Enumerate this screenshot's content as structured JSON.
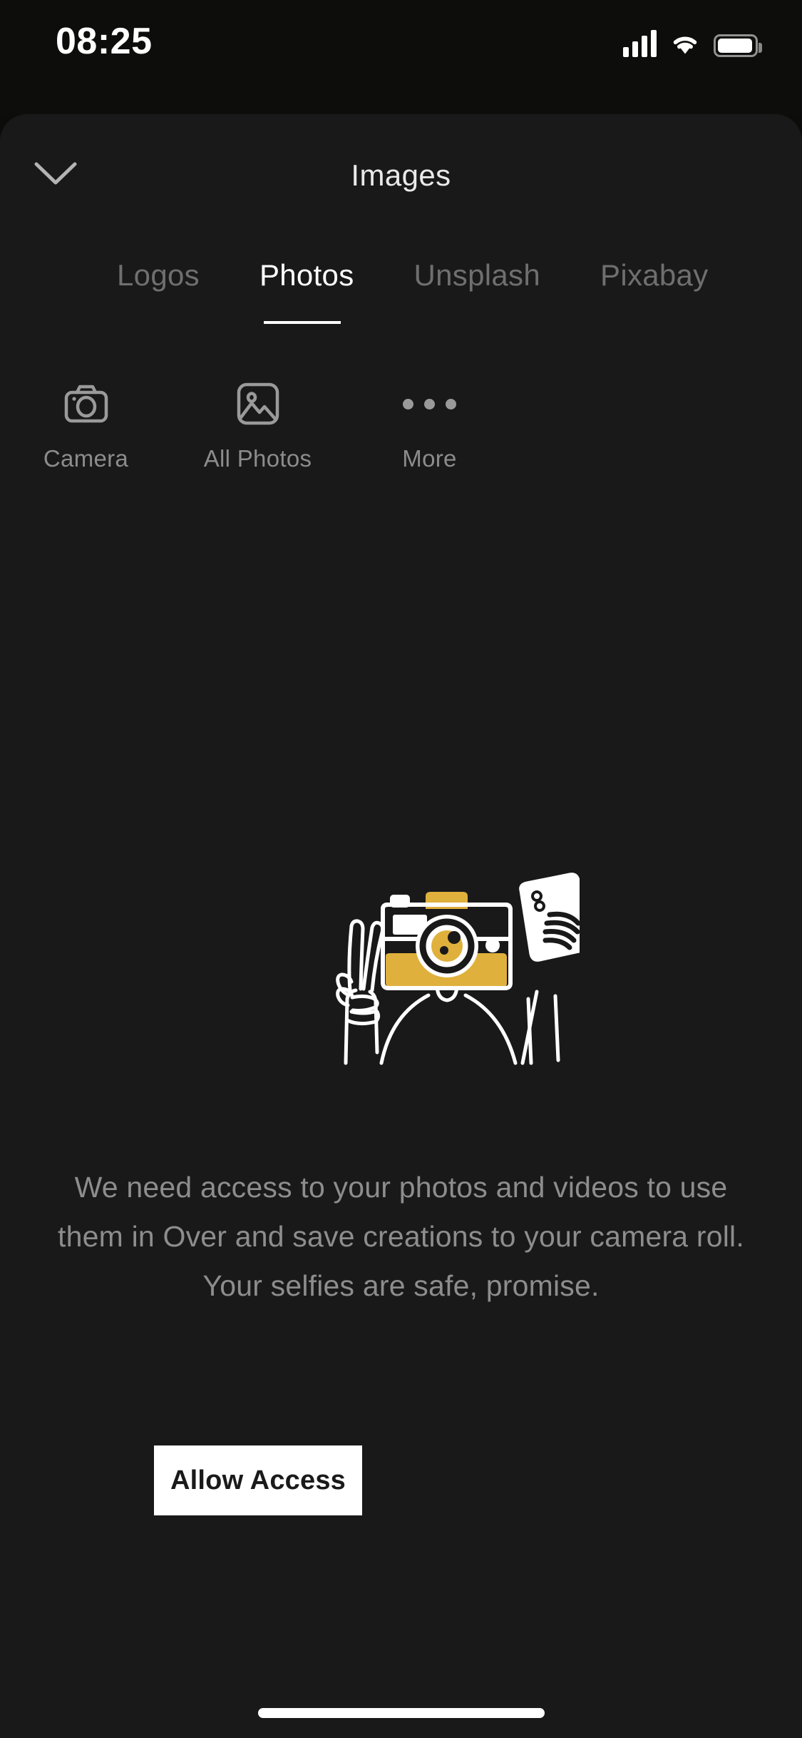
{
  "status_bar": {
    "time": "08:25",
    "cellular_icon": "cellular-signal-icon",
    "wifi_icon": "wifi-icon",
    "battery_icon": "battery-icon"
  },
  "sheet": {
    "title": "Images",
    "close_icon": "chevron-down-icon"
  },
  "tabs": [
    {
      "label": "Logos",
      "active": false
    },
    {
      "label": "Photos",
      "active": true
    },
    {
      "label": "Unsplash",
      "active": false
    },
    {
      "label": "Pixabay",
      "active": false
    }
  ],
  "quick_actions": [
    {
      "label": "Camera",
      "icon": "camera-icon"
    },
    {
      "label": "All Photos",
      "icon": "image-icon"
    },
    {
      "label": "More",
      "icon": "ellipsis-icon"
    }
  ],
  "permission": {
    "illustration": "peace-sign-camera-phone-illustration",
    "message": "We need access to your photos and videos to use them in Over and save creations to your camera roll. Your selfies are safe, promise.",
    "button_label": "Allow Access"
  },
  "colors": {
    "background": "#0c0c0b",
    "sheet": "#191919",
    "accent_gold": "#dfb03c",
    "text_primary": "#ffffff",
    "text_muted": "#8d8d8d",
    "button_bg": "#ffffff",
    "button_text": "#1a1a1a"
  }
}
